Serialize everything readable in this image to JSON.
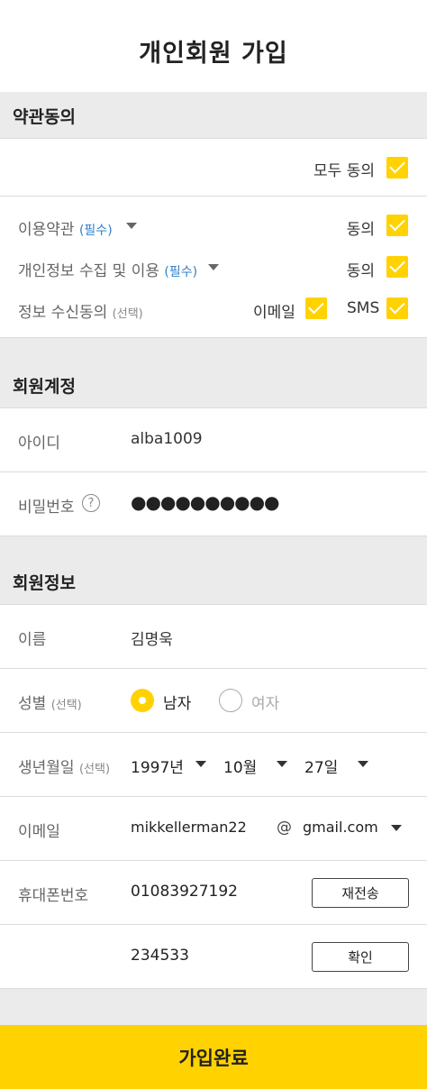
{
  "header": {
    "title": "개인회원 가입"
  },
  "terms": {
    "section_title": "약관동의",
    "all_agree_label": "모두 동의",
    "items": [
      {
        "label": "이용약관",
        "tag": "(필수)",
        "agree_label": "동의"
      },
      {
        "label": "개인정보 수집 및 이용",
        "tag": "(필수)",
        "agree_label": "동의"
      }
    ],
    "marketing": {
      "label": "정보 수신동의",
      "tag": "(선택)",
      "email_label": "이메일",
      "sms_label": "SMS"
    }
  },
  "account": {
    "section_title": "회원계정",
    "id_label": "아이디",
    "id_value": "alba1009",
    "password_label": "비밀번호",
    "password_help": "?",
    "password_value": "●●●●●●●●●●"
  },
  "profile": {
    "section_title": "회원정보",
    "name_label": "이름",
    "name_value": "김명욱",
    "gender_label": "성별",
    "gender_tag": "(선택)",
    "gender_options": [
      "남자",
      "여자"
    ],
    "gender_selected": "남자",
    "birth_label": "생년월일",
    "birth_tag": "(선택)",
    "birth_year": "1997년",
    "birth_month": "10월",
    "birth_day": "27일",
    "email_label": "이메일",
    "email_local": "mikkellerman22",
    "email_at": "@",
    "email_domain": "gmail.com",
    "phone_label": "휴대폰번호",
    "phone_value": "01083927192",
    "resend_label": "재전송",
    "code_value": "234533",
    "confirm_label": "확인"
  },
  "footer": {
    "submit_label": "가입완료"
  },
  "colors": {
    "accent": "#ffd200",
    "required": "#2f7fc9",
    "background": "#ebebeb"
  }
}
